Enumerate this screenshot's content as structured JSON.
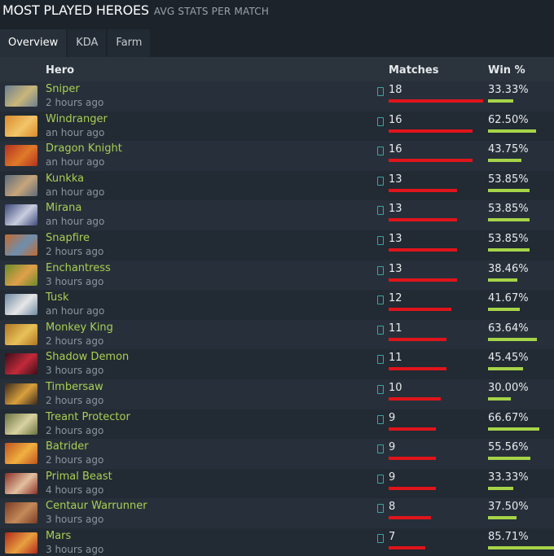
{
  "header": {
    "title": "MOST PLAYED HEROES",
    "subtitle": "AVG STATS PER MATCH"
  },
  "tabs": [
    {
      "label": "Overview",
      "active": true
    },
    {
      "label": "KDA",
      "active": false
    },
    {
      "label": "Farm",
      "active": false
    }
  ],
  "columns": {
    "hero": "Hero",
    "matches": "Matches",
    "win": "Win %"
  },
  "max_matches": 18,
  "heroes": [
    {
      "name": "Sniper",
      "time": "2 hours ago",
      "matches": "18",
      "win": "33.33%",
      "c1": "#6b7f8f",
      "c2": "#c9b67a"
    },
    {
      "name": "Windranger",
      "time": "an hour ago",
      "matches": "16",
      "win": "62.50%",
      "c1": "#d98a2b",
      "c2": "#f2c56a"
    },
    {
      "name": "Dragon Knight",
      "time": "an hour ago",
      "matches": "16",
      "win": "43.75%",
      "c1": "#b3301f",
      "c2": "#e07a2a"
    },
    {
      "name": "Kunkka",
      "time": "an hour ago",
      "matches": "13",
      "win": "53.85%",
      "c1": "#5b6b7a",
      "c2": "#c7a57a"
    },
    {
      "name": "Mirana",
      "time": "an hour ago",
      "matches": "13",
      "win": "53.85%",
      "c1": "#3d4a78",
      "c2": "#c9cde0"
    },
    {
      "name": "Snapfire",
      "time": "2 hours ago",
      "matches": "13",
      "win": "53.85%",
      "c1": "#c56a2e",
      "c2": "#6d8fb0"
    },
    {
      "name": "Enchantress",
      "time": "3 hours ago",
      "matches": "13",
      "win": "38.46%",
      "c1": "#6a8a2a",
      "c2": "#e0a04a"
    },
    {
      "name": "Tusk",
      "time": "an hour ago",
      "matches": "12",
      "win": "41.67%",
      "c1": "#6f8aa3",
      "c2": "#e6e6e6"
    },
    {
      "name": "Monkey King",
      "time": "2 hours ago",
      "matches": "11",
      "win": "63.64%",
      "c1": "#b07420",
      "c2": "#e8c15a"
    },
    {
      "name": "Shadow Demon",
      "time": "3 hours ago",
      "matches": "11",
      "win": "45.45%",
      "c1": "#3a0d18",
      "c2": "#c22a3a"
    },
    {
      "name": "Timbersaw",
      "time": "2 hours ago",
      "matches": "10",
      "win": "30.00%",
      "c1": "#3b2a1c",
      "c2": "#d9a03c"
    },
    {
      "name": "Treant Protector",
      "time": "2 hours ago",
      "matches": "9",
      "win": "66.67%",
      "c1": "#6a7040",
      "c2": "#d8d2a0"
    },
    {
      "name": "Batrider",
      "time": "2 hours ago",
      "matches": "9",
      "win": "55.56%",
      "c1": "#c0521e",
      "c2": "#f0b040"
    },
    {
      "name": "Primal Beast",
      "time": "4 hours ago",
      "matches": "9",
      "win": "33.33%",
      "c1": "#8a2f26",
      "c2": "#e2c0a0"
    },
    {
      "name": "Centaur Warrunner",
      "time": "3 hours ago",
      "matches": "8",
      "win": "37.50%",
      "c1": "#7a3a24",
      "c2": "#c48a5a"
    },
    {
      "name": "Mars",
      "time": "3 hours ago",
      "matches": "7",
      "win": "85.71%",
      "c1": "#b0281a",
      "c2": "#e8a040"
    }
  ]
}
